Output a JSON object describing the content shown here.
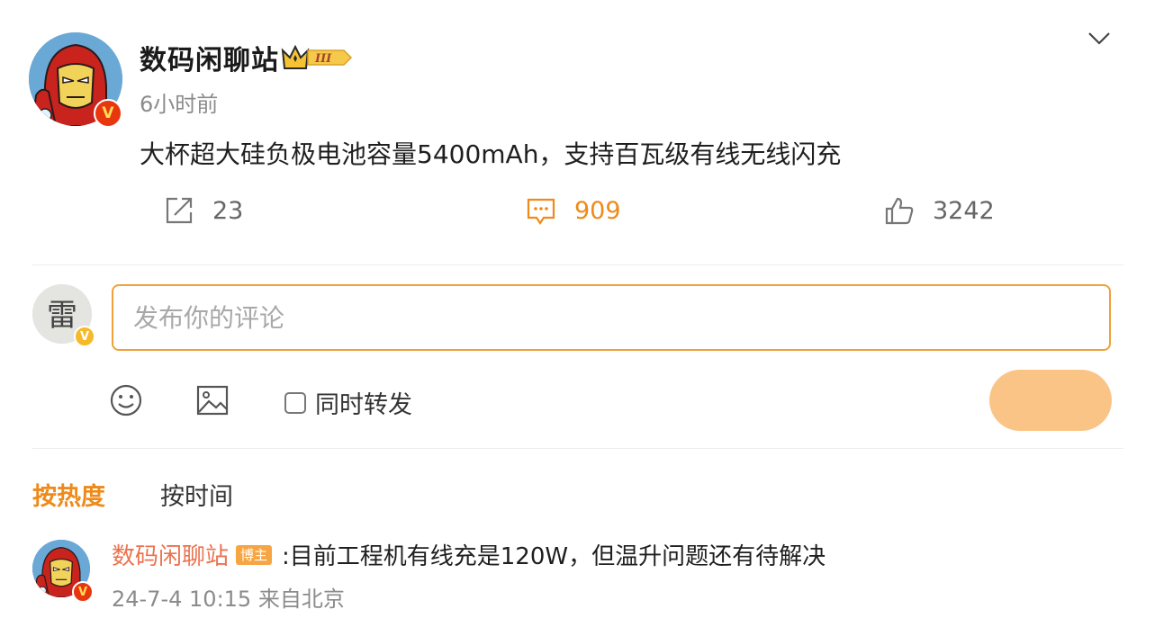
{
  "post": {
    "author": "数码闲聊站",
    "time": "6小时前",
    "text": "大杯超大硅负极电池容量5400mAh，支持百瓦级有线无线闪充",
    "avatar_badge": "V",
    "vip_level": "III",
    "menu_icon": "chevron-down-icon"
  },
  "actions": {
    "repost_count": "23",
    "comment_count": "909",
    "like_count": "3242",
    "repost_icon": "share-icon",
    "comment_icon": "comment-icon",
    "like_icon": "thumbs-up-icon"
  },
  "composer": {
    "placeholder": "发布你的评论",
    "value": "",
    "repost_label": "同时转发",
    "avatar_char": "雷",
    "avatar_badge": "V",
    "emoji_icon": "smiley-icon",
    "image_icon": "image-icon"
  },
  "sort_tabs": {
    "hot": "按热度",
    "time": "按时间"
  },
  "comments": [
    {
      "author": "数码闲聊站",
      "badge": "博主",
      "text": ":目前工程机有线充是120W，但温升问题还有待解决",
      "meta": "24-7-4 10:15 来自北京",
      "avatar_badge": "V"
    }
  ],
  "colors": {
    "accent": "#ee8a1a",
    "input_border": "#f0a13a",
    "submit_disabled": "#fbc487",
    "author_link": "#eb7350",
    "vip_red": "#e8360f"
  }
}
